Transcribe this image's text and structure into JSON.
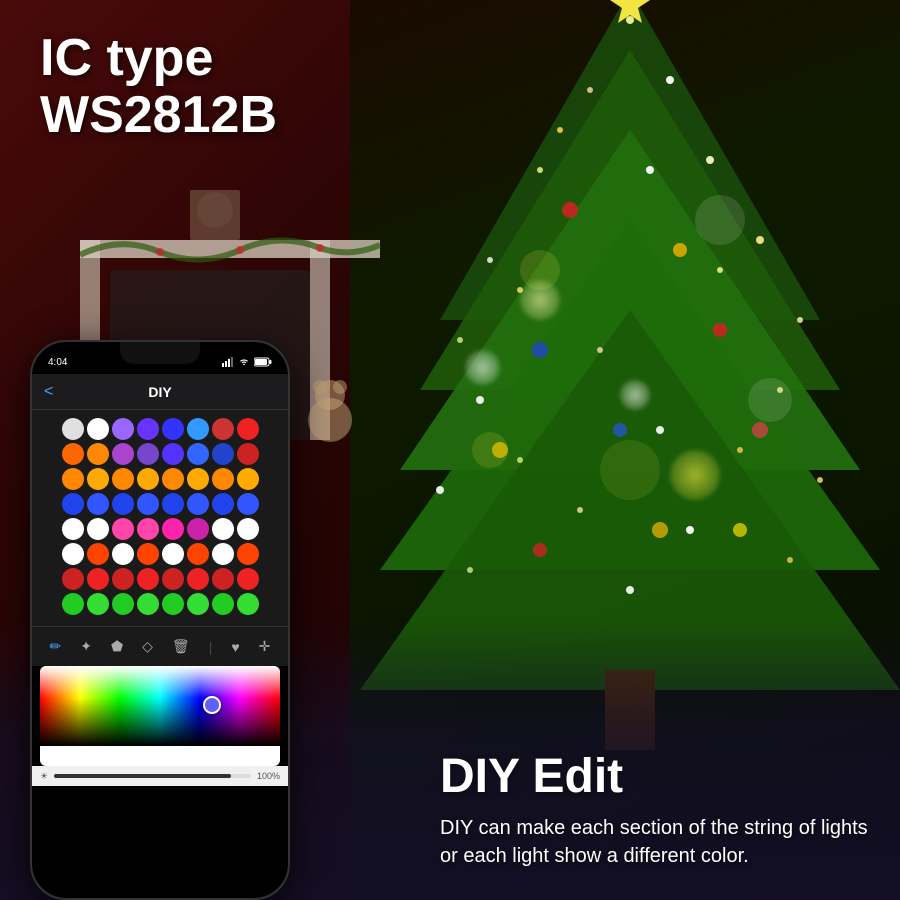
{
  "header": {
    "ic_label": "IC type",
    "ic_model": "WS2812B"
  },
  "phone": {
    "status_time": "4:04",
    "status_signal": "●●●",
    "nav_title": "DIY",
    "nav_back": "<",
    "brightness_label": "☀",
    "brightness_value": "100%"
  },
  "diy_section": {
    "title": "DIY Edit",
    "description": "DIY can make each section of the string of lights or each light show a different color."
  },
  "dot_rows": [
    [
      "#e0e0e0",
      "#ffffff",
      "#9966ff",
      "#6633ff",
      "#3333ff",
      "#3399ff",
      "#cc3333",
      "#ee2222"
    ],
    [
      "#ff6600",
      "#ff8800",
      "#aa44cc",
      "#7744cc",
      "#5533ff",
      "#3366ff",
      "#2244cc",
      "#cc2222"
    ],
    [
      "#ff8800",
      "#ffaa00",
      "#ff8800",
      "#ffaa00",
      "#ff8800",
      "#ffaa00",
      "#ff8800",
      "#ffaa00"
    ],
    [
      "#2244ee",
      "#3355ff",
      "#2244ee",
      "#3355ff",
      "#2244ee",
      "#3355ff",
      "#2244ee",
      "#3355ff"
    ],
    [
      "#ffffff",
      "#ffffff",
      "#ff44aa",
      "#ff44aa",
      "#ff22aa",
      "#cc22aa",
      "#ffffff",
      "#ffffff"
    ],
    [
      "#ffffff",
      "#ff4400",
      "#ffffff",
      "#ff4400",
      "#ffffff",
      "#ff4400",
      "#ffffff",
      "#ff4400"
    ],
    [
      "#cc2222",
      "#ee2222",
      "#cc2222",
      "#ee2222",
      "#cc2222",
      "#ee2222",
      "#cc2222",
      "#ee2222"
    ],
    [
      "#22cc22",
      "#33dd33",
      "#22cc22",
      "#33dd33",
      "#22cc22",
      "#33dd33",
      "#22cc22",
      "#33dd33"
    ]
  ],
  "tools": [
    "✏️",
    "✨",
    "🪣",
    "◇",
    "🗑",
    "♥",
    "✛"
  ]
}
